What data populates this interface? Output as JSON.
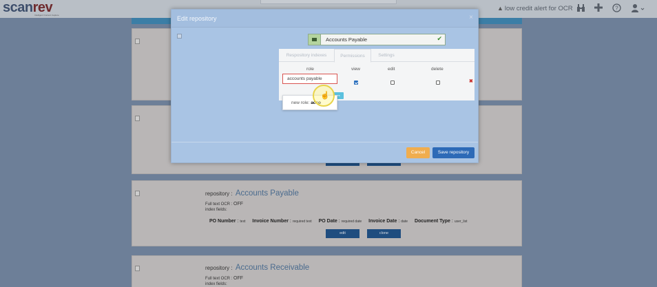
{
  "header": {
    "logo_part1": "scan",
    "logo_part2": "rev",
    "logo_tagline": "Intelligent Content Capture",
    "ocr_alert": "low credit alert for OCR",
    "icons": [
      "binoculars-icon",
      "plus-icon",
      "help-icon",
      "user-icon"
    ]
  },
  "modal": {
    "title": "Edit repository",
    "close": "×",
    "name_value": "Accounts Payable",
    "tabs": [
      {
        "label": "Respository indexes",
        "active": false
      },
      {
        "label": "Permissions",
        "active": true
      },
      {
        "label": "Settings",
        "active": false
      }
    ],
    "columns": {
      "role": "role",
      "view": "view",
      "edit": "edit",
      "delete": "delete"
    },
    "permission_row": {
      "role_value": "accounts payable",
      "view": true,
      "edit": false,
      "delete": false
    },
    "dropdown": {
      "prefix": "new role:",
      "typed": "acco"
    },
    "add_chip": "es",
    "buttons": {
      "cancel": "Cancel",
      "save": "Save repository"
    }
  },
  "cards": [
    {
      "repo_label": "repository :",
      "name": "Accounts Payable",
      "ocr_label": "Full text OCR :",
      "ocr_value": "OFF",
      "index_label": "index fields:",
      "fields": [
        {
          "name": "PO Number",
          "type": "text"
        },
        {
          "name": "Invoice Number",
          "type": "required text"
        },
        {
          "name": "PO Date",
          "type": "required date"
        },
        {
          "name": "Invoice Date",
          "type": "date"
        },
        {
          "name": "Document Type",
          "type": "user_list"
        }
      ],
      "edit": "edit",
      "clone": "clone"
    },
    {
      "repo_label": "repository :",
      "name": "Accounts Receivable",
      "ocr_label": "Full text OCR :",
      "ocr_value": "OFF",
      "index_label": "index fields:"
    }
  ],
  "colors": {
    "accent": "#2d6ab7",
    "cancel": "#f0ad4e",
    "modal_bg": "#a9c4e4",
    "error_border": "#d9534f"
  }
}
